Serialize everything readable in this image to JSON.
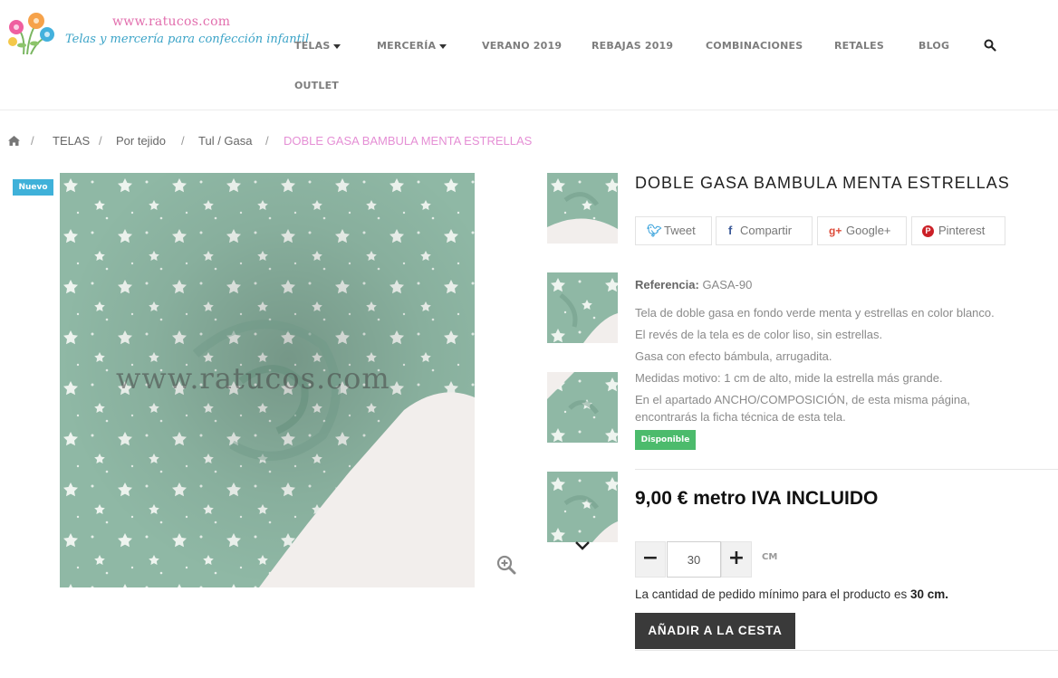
{
  "header": {
    "logo_url": "www.ratucos.com",
    "logo_tagline": "Telas y mercería para confección infantil",
    "nav": [
      {
        "label": "TELAS",
        "has_caret": true
      },
      {
        "label": "MERCERÍA",
        "has_caret": true
      },
      {
        "label": "VERANO 2019"
      },
      {
        "label": "REBAJAS 2019"
      },
      {
        "label": "COMBINACIONES"
      },
      {
        "label": "RETALES"
      },
      {
        "label": "BLOG"
      },
      {
        "label": "OUTLET"
      }
    ],
    "search_icon": "search-icon"
  },
  "breadcrumb": {
    "home_icon": "home-icon",
    "separator": "/",
    "items": [
      "TELAS",
      "Por tejido",
      "Tul / Gasa"
    ],
    "current": "DOBLE GASA BAMBULA MENTA ESTRELLAS"
  },
  "product": {
    "badge": "Nuevo",
    "watermark": "www.ratucos.com",
    "title": "DOBLE GASA BAMBULA MENTA ESTRELLAS",
    "share": [
      {
        "icon": "twitter-icon",
        "label": "Tweet"
      },
      {
        "icon": "facebook-icon",
        "label": "Compartir"
      },
      {
        "icon": "google-plus-icon",
        "label": "Google+"
      },
      {
        "icon": "pinterest-icon",
        "label": "Pinterest"
      }
    ],
    "reference_label": "Referencia:",
    "reference_value": "GASA-90",
    "description": [
      "Tela de doble gasa en fondo verde menta y estrellas en color blanco.",
      "El revés de la tela es de color liso, sin estrellas.",
      "Gasa con efecto bámbula, arrugadita.",
      "Medidas motivo: 1 cm de alto, mide la estrella más grande.",
      "En el apartado ANCHO/COMPOSICIÓN, de esta misma página,",
      "encontrarás la ficha técnica de esta tela."
    ],
    "availability": "Disponible",
    "price": "9,00 € metro IVA INCLUIDO",
    "quantity": {
      "minus": "−",
      "value": "30",
      "plus": "+",
      "unit": "CM"
    },
    "min_qty_text": "La cantidad de pedido mínimo para el producto es",
    "min_qty_value": "30 cm.",
    "add_to_cart": "AÑADIR A LA CESTA"
  },
  "colors": {
    "fabric": "#8fb8a5",
    "accent_pink": "#e58fd5",
    "badge_new": "#3fb1d9",
    "available": "#4cbb6c",
    "button_dark": "#3a3a3a"
  }
}
